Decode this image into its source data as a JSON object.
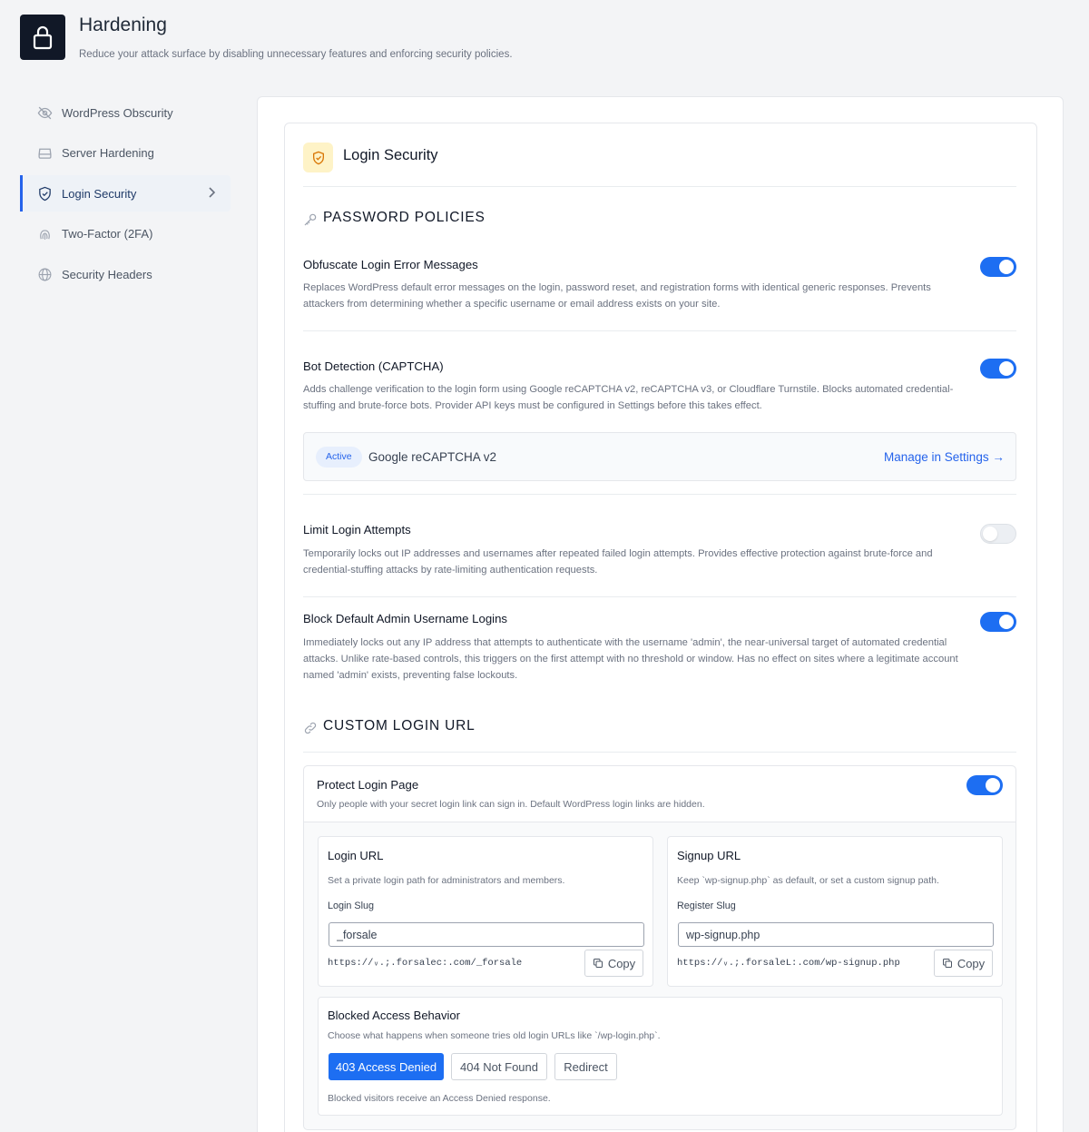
{
  "header": {
    "title": "Hardening",
    "subtitle": "Reduce your attack surface by disabling unnecessary features and enforcing security policies."
  },
  "sidebar": {
    "items": [
      {
        "label": "WordPress Obscurity",
        "icon": "eye-off-icon"
      },
      {
        "label": "Server Hardening",
        "icon": "server-icon"
      },
      {
        "label": "Login Security",
        "icon": "shield-check-icon",
        "active": true
      },
      {
        "label": "Two-Factor (2FA)",
        "icon": "fingerprint-icon"
      },
      {
        "label": "Security Headers",
        "icon": "globe-icon"
      }
    ]
  },
  "card": {
    "title": "Login Security"
  },
  "password_policies": {
    "title": "PASSWORD POLICIES",
    "options": [
      {
        "title": "Obfuscate Login Error Messages",
        "desc": "Replaces WordPress default error messages on the login, password reset, and registration forms with identical generic responses. Prevents attackers from determining whether a specific username or email address exists on your site.",
        "enabled": true
      },
      {
        "title": "Bot Detection (CAPTCHA)",
        "desc": "Adds challenge verification to the login form using Google reCAPTCHA v2, reCAPTCHA v3, or Cloudflare Turnstile. Blocks automated credential-stuffing and brute-force bots. Provider API keys must be configured in Settings before this takes effect.",
        "enabled": true
      },
      {
        "title": "Limit Login Attempts",
        "desc": "Temporarily locks out IP addresses and usernames after repeated failed login attempts. Provides effective protection against brute-force and credential-stuffing attacks by rate-limiting authentication requests.",
        "enabled": false
      },
      {
        "title": "Block Default Admin Username Logins",
        "desc": "Immediately locks out any IP address that attempts to authenticate with the username 'admin', the near-universal target of automated credential attacks. Unlike rate-based controls, this triggers on the first attempt with no threshold or window. Has no effect on sites where a legitimate account named 'admin' exists, preventing false lockouts.",
        "enabled": true
      }
    ],
    "captcha": {
      "badge": "Active",
      "provider": "Google reCAPTCHA v2",
      "manage_link": "Manage in Settings →"
    }
  },
  "custom_login_url": {
    "title": "CUSTOM LOGIN URL",
    "protect": {
      "title": "Protect Login Page",
      "desc": "Only people with your secret login link can sign in. Default WordPress login links are hidden.",
      "enabled": true
    },
    "login_url": {
      "title": "Login URL",
      "desc": "Set a private login path for administrators and members.",
      "field_label": "Login Slug",
      "value": "_forsale",
      "full_url": "https://ᵥ.;.forsalec:.com/_forsale",
      "copy_label": "Copy"
    },
    "signup_url": {
      "title": "Signup URL",
      "desc": "Keep `wp-signup.php` as default, or set a custom signup path.",
      "field_label": "Register Slug",
      "value": "wp-signup.php",
      "full_url": "https://ᵥ.;.forsaleL:.com/wp-signup.php",
      "copy_label": "Copy"
    },
    "blocked": {
      "title": "Blocked Access Behavior",
      "desc": "Choose what happens when someone tries old login URLs like `/wp-login.php`.",
      "options": [
        "403 Access Denied",
        "404 Not Found",
        "Redirect"
      ],
      "selected": "403 Access Denied",
      "note": "Blocked visitors receive an Access Denied response."
    }
  },
  "colors": {
    "accent": "#1d6ef2",
    "header_icon_bg": "#111827",
    "card_icon_bg": "#fef3c7",
    "card_icon_fg": "#d97706"
  }
}
